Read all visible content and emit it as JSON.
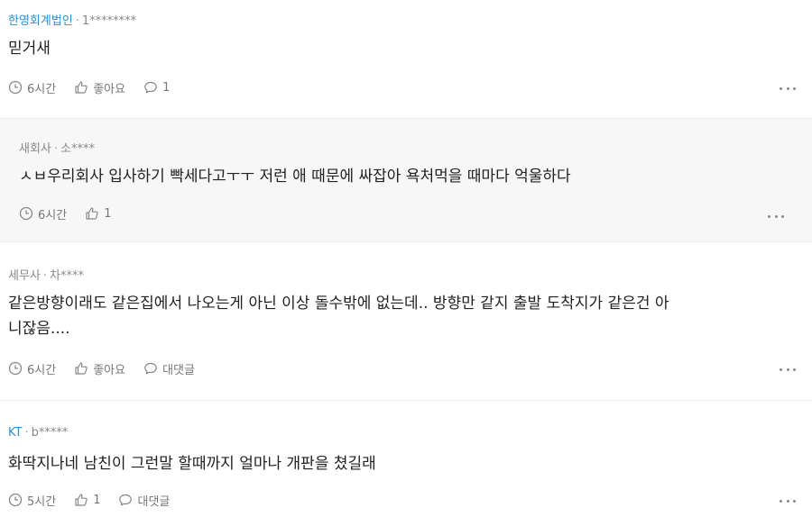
{
  "comments": [
    {
      "author": "한영회계법인",
      "separator": "·",
      "user": "1********",
      "text": "믿거새",
      "time": "6시간",
      "like": "좋아요",
      "reply": "1"
    },
    {
      "author": "새회사",
      "separator": "·",
      "user": "소****",
      "text": "ㅅㅂ우리회사 입사하기 빡세다고ㅜㅜ 저런 애 때문에 싸잡아 욕처먹을 때마다 억울하다",
      "time": "6시간",
      "like": "1"
    },
    {
      "author": "세무사",
      "separator": "·",
      "user": "차****",
      "text_line1": "같은방향이래도 같은집에서 나오는게 아닌 이상 돌수밖에 없는데.. 방향만 같지 출발 도착지가 같은건 아",
      "text_line2": "니잖음....",
      "time": "6시간",
      "like": "좋아요",
      "reply": "대댓글"
    },
    {
      "author": "KT",
      "separator": "·",
      "user": "b*****",
      "text": "화딱지나네 남친이 그런말 할때까지 얼마나 개판을 쳤길래",
      "time": "5시간",
      "like": "1",
      "reply": "대댓글"
    }
  ],
  "colors": {
    "company_author": "#2d8fd0",
    "reply_background": "#f7f7f8",
    "divider": "#ececec"
  },
  "icons": [
    "clock-icon",
    "thumbs-up-icon",
    "speech-bubble-icon",
    "more-dots-icon"
  ]
}
